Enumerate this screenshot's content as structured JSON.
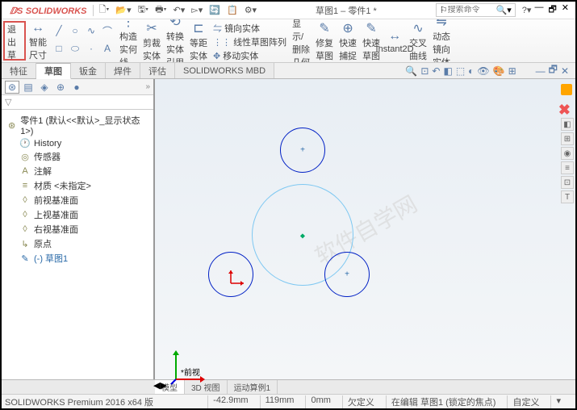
{
  "app": {
    "logo": "SOLIDWORKS",
    "doc_title": "草图1 – 零件1 *",
    "search_placeholder": "搜索命令"
  },
  "ribbon": {
    "exit_sketch": "退出草图",
    "smart_dim": "智能尺寸",
    "trim": "构造实何线",
    "trim_ent": "剪裁实体",
    "convert": "转换实体引用",
    "offset": "等距实体",
    "mirror": "镜向实体",
    "linear_pattern": "线性草图阵列",
    "move": "移动实体",
    "display_del": "显示/删除几何关系",
    "repair": "修复草图",
    "quick_snap": "快速捕捉",
    "rapid": "快速草图",
    "instant2d": "Instant2D",
    "shaded": "交叉曲线",
    "dynamic_mirror": "动态镜向实体"
  },
  "tabs": {
    "feature": "特征",
    "sketch": "草图",
    "sheetmetal": "钣金",
    "weldment": "焊件",
    "evaluate": "评估",
    "mbd": "SOLIDWORKS MBD"
  },
  "tree": {
    "root": "零件1 (默认<<默认>_显示状态 1>)",
    "history": "History",
    "sensors": "传感器",
    "annotations": "注解",
    "material": "材质 <未指定>",
    "front_plane": "前视基准面",
    "top_plane": "上视基准面",
    "right_plane": "右视基准面",
    "origin": "原点",
    "sketch1": "(-) 草图1"
  },
  "viewport": {
    "view_label": "*前视"
  },
  "bottom_tabs": {
    "model": "模型",
    "view3d": "3D 视图",
    "motion": "运动算例1"
  },
  "status": {
    "product": "SOLIDWORKS Premium 2016 x64 版",
    "x": "-42.9mm",
    "y": "119mm",
    "z": "0mm",
    "underdefined": "欠定义",
    "editing": "在编辑 草图1 (锁定的焦点)",
    "custom": "自定义"
  },
  "watermark": "软件自学网"
}
